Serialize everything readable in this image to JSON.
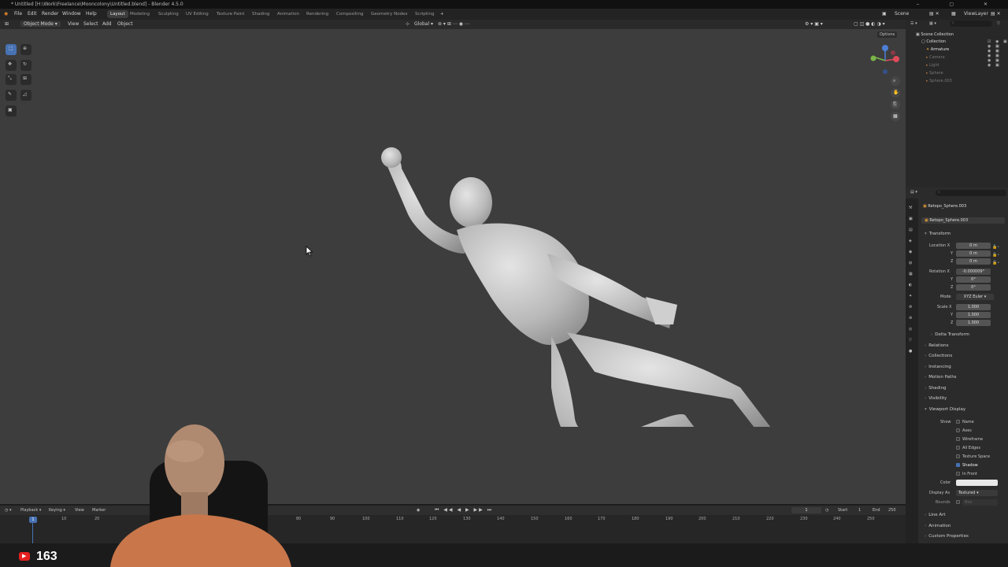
{
  "window": {
    "title": "* Untitled [H:\\Work\\Freelance\\Mooncolony\\Untitled.blend] - Blender 4.5.0"
  },
  "menus": [
    "File",
    "Edit",
    "Render",
    "Window",
    "Help"
  ],
  "workspaces": [
    "Layout",
    "Modeling",
    "Sculpting",
    "UV Editing",
    "Texture Paint",
    "Shading",
    "Animation",
    "Rendering",
    "Compositing",
    "Geometry Nodes",
    "Scripting"
  ],
  "workspace_add": "+",
  "scene": {
    "label": "Scene",
    "view_layer": "ViewLayer"
  },
  "viewport_header": {
    "mode": "Object Mode",
    "menus": [
      "View",
      "Select",
      "Add",
      "Object"
    ],
    "orientation": "Global",
    "options": "Options"
  },
  "outliner": {
    "search_placeholder": "",
    "root": "Scene Collection",
    "collection": "Collection",
    "items": [
      "Armature",
      "Camera",
      "Light",
      "Sphere",
      "Sphere.003"
    ]
  },
  "properties": {
    "object_name": "Retopo_Sphere.003",
    "object_field": "Retopo_Sphere.003",
    "transform": {
      "title": "Transform",
      "location_label": "Location X",
      "location": [
        "0 m",
        "0 m",
        "0 m"
      ],
      "rotation_label": "Rotation X",
      "rotation": [
        "-0.000009°",
        "0°",
        "0°"
      ],
      "mode_label": "Mode",
      "mode": "XYZ Euler",
      "scale_label": "Scale X",
      "scale": [
        "1.000",
        "1.000",
        "1.000"
      ],
      "axis_y": "Y",
      "axis_z": "Z",
      "delta": "Delta Transform"
    },
    "panels": [
      "Relations",
      "Collections",
      "Instancing",
      "Motion Paths",
      "Shading",
      "Visibility"
    ],
    "viewport_display": {
      "title": "Viewport Display",
      "show_label": "Show",
      "options": [
        {
          "label": "Name",
          "checked": false
        },
        {
          "label": "Axes",
          "checked": false
        },
        {
          "label": "Wireframe",
          "checked": false
        },
        {
          "label": "All Edges",
          "checked": false
        },
        {
          "label": "Texture Space",
          "checked": false
        },
        {
          "label": "Shadow",
          "checked": true
        },
        {
          "label": "In Front",
          "checked": false
        }
      ],
      "color_label": "Color",
      "display_as_label": "Display As",
      "display_as": "Textured",
      "bounds_label": "Bounds",
      "bounds": "Box"
    },
    "bottom_panels": [
      "Line Art",
      "Animation",
      "Custom Properties"
    ]
  },
  "timeline": {
    "menus": [
      "Playback",
      "Keying",
      "View",
      "Marker"
    ],
    "current_frame": "1",
    "start_label": "Start",
    "start": "1",
    "end_label": "End",
    "end": "250",
    "ticks": [
      "10",
      "20",
      "80",
      "90",
      "100",
      "110",
      "120",
      "130",
      "140",
      "150",
      "160",
      "170",
      "180",
      "190",
      "200",
      "210",
      "220",
      "230",
      "240",
      "250"
    ],
    "playhead": "1"
  },
  "overlay": {
    "subscriber_count": "163"
  },
  "colors": {
    "accent": "#4772b3",
    "viewport": "#3d3d3d",
    "shirt": "#c8764a"
  }
}
